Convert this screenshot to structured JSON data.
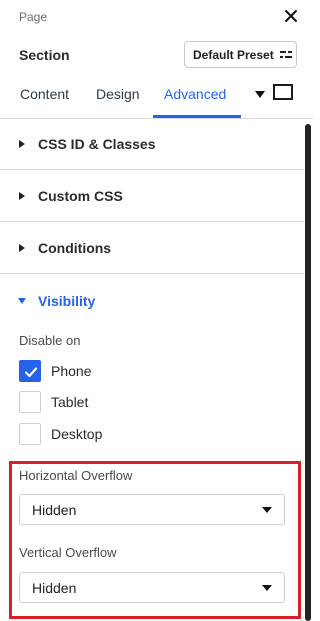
{
  "header": {
    "breadcrumb": "Page",
    "section_label": "Section",
    "preset_button": "Default Preset"
  },
  "tabs": [
    {
      "label": "Content",
      "active": false
    },
    {
      "label": "Design",
      "active": false
    },
    {
      "label": "Advanced",
      "active": true
    }
  ],
  "accordion": [
    {
      "label": "CSS ID & Classes",
      "expanded": false
    },
    {
      "label": "Custom CSS",
      "expanded": false
    },
    {
      "label": "Conditions",
      "expanded": false
    },
    {
      "label": "Visibility",
      "expanded": true
    }
  ],
  "visibility": {
    "disable_on_label": "Disable on",
    "options": [
      {
        "label": "Phone",
        "checked": true
      },
      {
        "label": "Tablet",
        "checked": false
      },
      {
        "label": "Desktop",
        "checked": false
      }
    ]
  },
  "overflow": {
    "horizontal_label": "Horizontal Overflow",
    "horizontal_value": "Hidden",
    "vertical_label": "Vertical Overflow",
    "vertical_value": "Hidden"
  },
  "colors": {
    "accent": "#2563eb",
    "highlight_border": "#d81f26",
    "divider": "#dcdcdc"
  },
  "icons": {
    "close": "close-icon",
    "preset": "preset-options-icon",
    "tab_more": "caret-down-icon",
    "view": "square-view-icon",
    "collapsed": "caret-right-icon",
    "expanded": "caret-down-icon",
    "check": "check-icon",
    "select": "dropdown-arrow-icon"
  }
}
